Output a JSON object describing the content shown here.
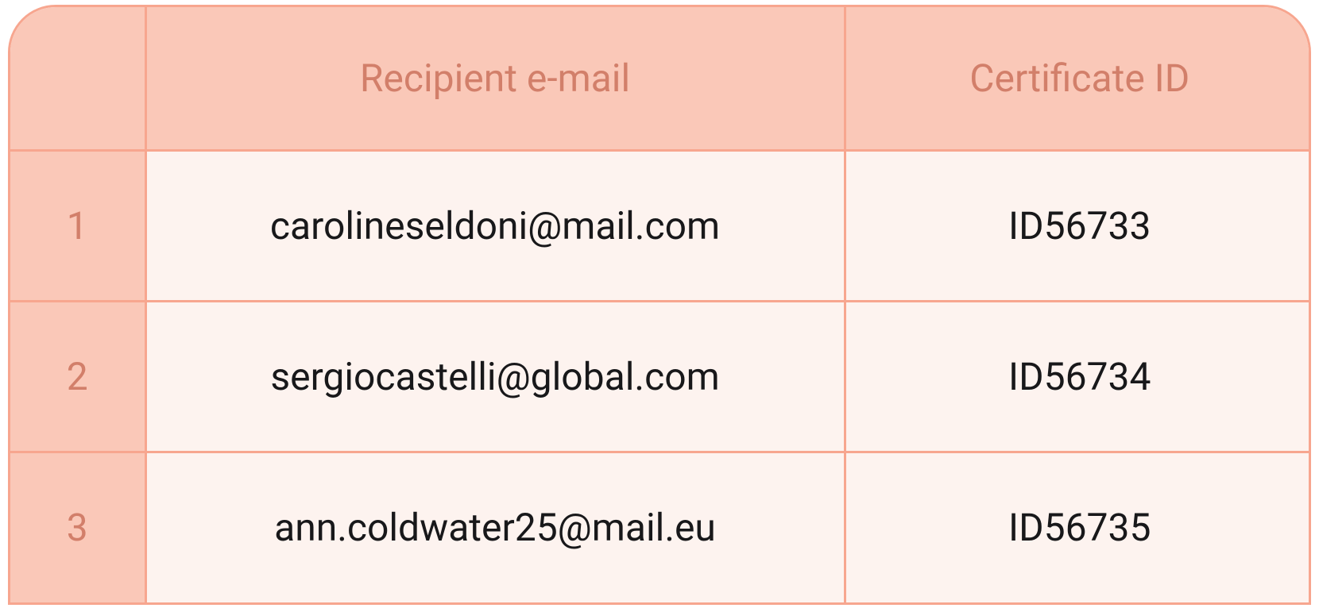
{
  "table": {
    "headers": {
      "index": "",
      "email": "Recipient e-mail",
      "certificate": "Certificate ID"
    },
    "rows": [
      {
        "index": "1",
        "email": "carolineseldoni@mail.com",
        "certificate": "ID56733"
      },
      {
        "index": "2",
        "email": "sergiocastelli@global.com",
        "certificate": "ID56734"
      },
      {
        "index": "3",
        "email": "ann.coldwater25@mail.eu",
        "certificate": "ID56735"
      }
    ]
  }
}
